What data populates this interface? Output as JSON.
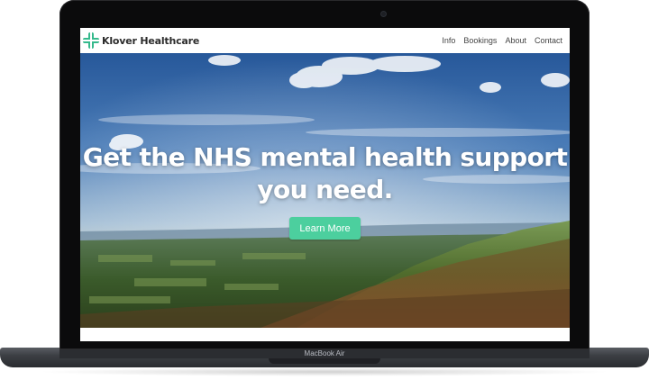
{
  "device": {
    "label": "MacBook Air"
  },
  "site": {
    "brand_name": "Klover Healthcare",
    "brand_icon": "green-cross-icon",
    "accent_color": "#4ccf9e"
  },
  "nav": {
    "items": [
      {
        "label": "Info"
      },
      {
        "label": "Bookings"
      },
      {
        "label": "About"
      },
      {
        "label": "Contact"
      }
    ]
  },
  "hero": {
    "title": "Get the NHS mental health support you need.",
    "button_label": "Learn More"
  }
}
